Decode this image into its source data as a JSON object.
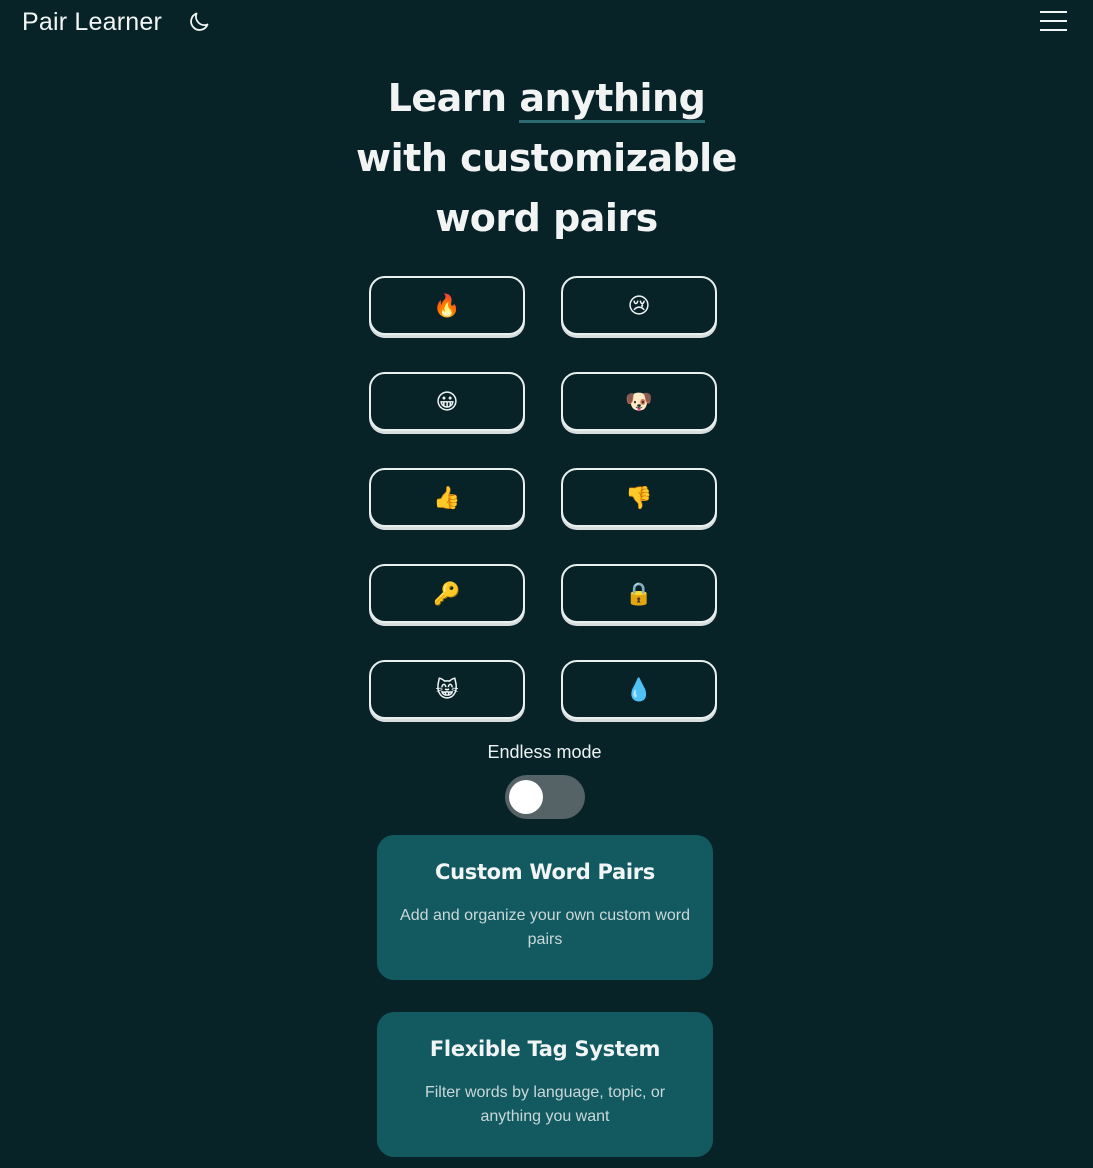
{
  "header": {
    "brand": "Pair Learner",
    "theme_toggle_icon": "moon-icon",
    "menu_icon": "hamburger-menu-icon"
  },
  "hero": {
    "line1_prefix": "Learn ",
    "line1_accent": "anything",
    "line2": "with customizable",
    "line3": "word pairs"
  },
  "emoji_buttons": [
    {
      "emoji": "🔥",
      "icon": "fire-icon"
    },
    {
      "emoji": "😢",
      "icon": "crying-face-icon"
    },
    {
      "emoji": "😀",
      "icon": "grinning-face-icon"
    },
    {
      "emoji": "🐶",
      "icon": "dog-face-icon"
    },
    {
      "emoji": "👍",
      "icon": "thumbs-up-icon"
    },
    {
      "emoji": "👎",
      "icon": "thumbs-down-icon"
    },
    {
      "emoji": "🔑",
      "icon": "key-icon"
    },
    {
      "emoji": "🔒",
      "icon": "lock-icon"
    },
    {
      "emoji": "😸",
      "icon": "cat-face-icon"
    },
    {
      "emoji": "💧",
      "icon": "droplet-icon"
    }
  ],
  "endless_mode": {
    "label": "Endless mode",
    "enabled": false
  },
  "features": [
    {
      "title": "Custom Word Pairs",
      "description": "Add and organize your own custom word pairs"
    },
    {
      "title": "Flexible Tag System",
      "description": "Filter words by language, topic, or anything you want"
    }
  ],
  "colors": {
    "background": "#072328",
    "card": "#125960",
    "toggle_off": "#566366",
    "accent_underline": "#2a6a70"
  }
}
